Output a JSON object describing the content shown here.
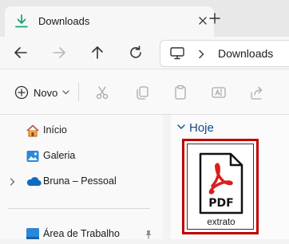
{
  "tab": {
    "title": "Downloads",
    "close_icon": "close-icon",
    "new_tab_icon": "plus-icon"
  },
  "address": {
    "segment": "Downloads",
    "root_icon": "computer-icon"
  },
  "toolbar": {
    "new_label": "Novo"
  },
  "sidebar": {
    "items": [
      {
        "label": "Início",
        "icon": "home-icon"
      },
      {
        "label": "Galeria",
        "icon": "gallery-icon"
      },
      {
        "label": "Bruna – Pessoal",
        "icon": "cloud-icon"
      },
      {
        "label": "Área de Trabalho",
        "icon": "desktop-icon"
      }
    ]
  },
  "content": {
    "group_label": "Hoje",
    "files": [
      {
        "name": "extrato",
        "type_label": "PDF"
      }
    ]
  },
  "colors": {
    "accent": "#0067c0",
    "pdf_red": "#d81e1e",
    "selection": "#c00000"
  }
}
